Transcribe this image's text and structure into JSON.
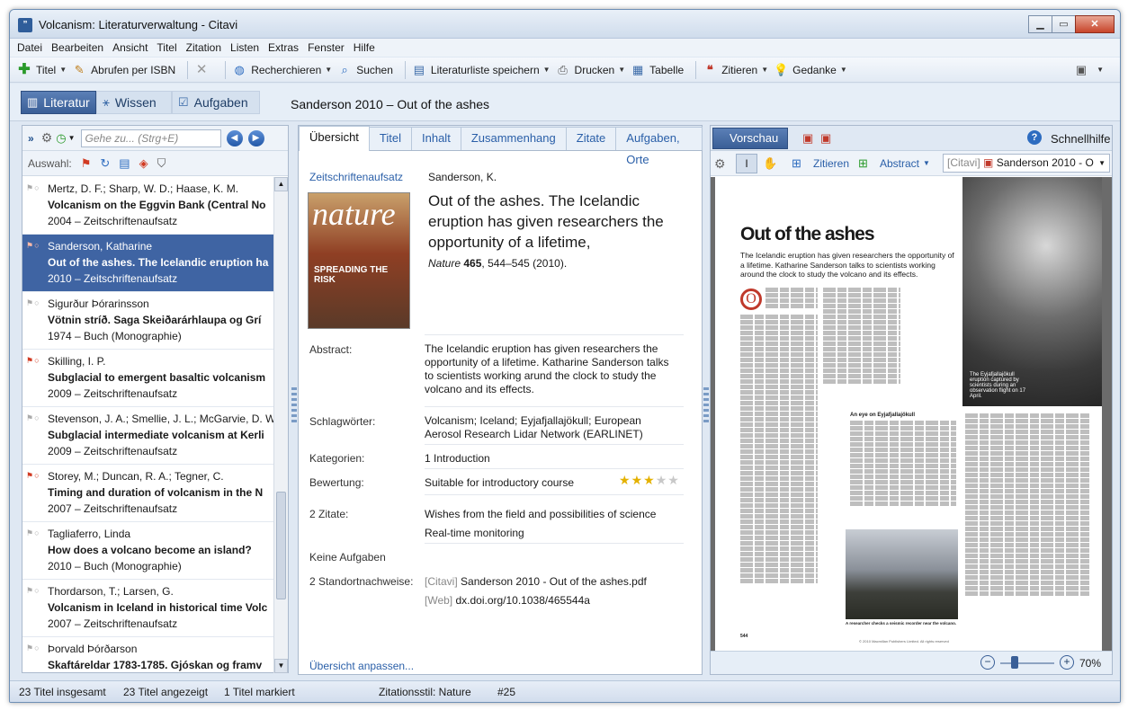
{
  "window": {
    "title": "Volcanism: Literaturverwaltung - Citavi",
    "app_icon": "”"
  },
  "menu": [
    "Datei",
    "Bearbeiten",
    "Ansicht",
    "Titel",
    "Zitation",
    "Listen",
    "Extras",
    "Fenster",
    "Hilfe"
  ],
  "toolbar": {
    "titel": "Titel",
    "abrufen": "Abrufen per ISBN",
    "recherchieren": "Recherchieren",
    "suchen": "Suchen",
    "literaturliste": "Literaturliste speichern",
    "drucken": "Drucken",
    "tabelle": "Tabelle",
    "zitieren": "Zitieren",
    "gedanke": "Gedanke"
  },
  "nav": {
    "literatur": "Literatur",
    "wissen": "Wissen",
    "aufgaben": "Aufgaben"
  },
  "breadcrumb": "Sanderson 2010 – Out of the ashes",
  "left": {
    "search_placeholder": "Gehe zu... (Strg+E)",
    "auswahl": "Auswahl:",
    "items": [
      {
        "authors": "Mertz, D. F.; Sharp, W. D.; Haase, K. M.",
        "title": "Volcanism on the Eggvin Bank (Central No",
        "meta": "2004 – Zeitschriftenaufsatz",
        "flag": false,
        "selected": false
      },
      {
        "authors": "Sanderson, Katharine",
        "title": "Out of the ashes. The Icelandic eruption ha",
        "meta": "2010 – Zeitschriftenaufsatz",
        "flag": true,
        "selected": true
      },
      {
        "authors": "Sigurður Þórarinsson",
        "title": "Vötnin stríð. Saga Skeiðarárhlaupa og Grí",
        "meta": "1974 – Buch (Monographie)",
        "flag": false,
        "selected": false
      },
      {
        "authors": "Skilling, I. P.",
        "title": "Subglacial to emergent basaltic volcanism",
        "meta": "2009 – Zeitschriftenaufsatz",
        "flag": true,
        "selected": false
      },
      {
        "authors": "Stevenson, J. A.; Smellie, J. L.; McGarvie, D. W.;",
        "title": "Subglacial intermediate volcanism at Kerli",
        "meta": "2009 – Zeitschriftenaufsatz",
        "flag": false,
        "selected": false
      },
      {
        "authors": "Storey, M.; Duncan, R. A.; Tegner, C.",
        "title": "Timing and duration of volcanism in the N",
        "meta": "2007 – Zeitschriftenaufsatz",
        "flag": true,
        "selected": false
      },
      {
        "authors": "Tagliaferro, Linda",
        "title": "How does a volcano become an island?",
        "meta": "2010 – Buch (Monographie)",
        "flag": false,
        "selected": false
      },
      {
        "authors": "Thordarson, T.; Larsen, G.",
        "title": "Volcanism in Iceland in historical time Volc",
        "meta": "2007 – Zeitschriftenaufsatz",
        "flag": false,
        "selected": false
      },
      {
        "authors": "Þorvald Þórðarson",
        "title": "Skaftáreldar 1783-1785. Gjóskan og framv",
        "meta": "",
        "flag": false,
        "selected": false
      }
    ]
  },
  "mid": {
    "tabs": [
      "Übersicht",
      "Titel",
      "Inhalt",
      "Zusammenhang",
      "Zitate",
      "Aufgaben, Orte"
    ],
    "type": "Zeitschriftenaufsatz",
    "author": "Sanderson, K.",
    "title": "Out of the ashes. The Icelandic eruption has given researchers the opportunity of a lifetime,",
    "journal": "Nature",
    "volume": "465",
    "pages": ", 544–545 (2010).",
    "cover_logo": "nature",
    "cover_tag": "SPREADING THE RISK",
    "abstract_label": "Abstract:",
    "abstract": "The Icelandic eruption has given researchers the opportunity of a lifetime. Katharine Sanderson talks to scientists working arund the clock to study the volcano and its effects.",
    "keywords_label": "Schlagwörter:",
    "keywords": "Volcanism; Iceland; Eyjafjallajökull; European Aerosol Research Lidar Network (EARLINET)",
    "categories_label": "Kategorien:",
    "categories": "1 Introduction",
    "rating_label": "Bewertung:",
    "rating_text": "Suitable for introductory course",
    "rating_value": 3,
    "rating_max": 5,
    "quotes_label": "2 Zitate:",
    "quote1": "Wishes from the field and possibilities of science",
    "quote2": "Real-time monitoring",
    "tasks_label": "Keine Aufgaben",
    "locations_label": "2 Standortnachweise:",
    "loc1_tag": "[Citavi]",
    "loc1": "Sanderson 2010 - Out of the ashes.pdf",
    "loc2_tag": "[Web]",
    "loc2": "dx.doi.org/10.1038/465544a",
    "customize": "Übersicht anpassen..."
  },
  "right": {
    "vorschau": "Vorschau",
    "schnellhilfe": "Schnellhilfe",
    "zitieren": "Zitieren",
    "abstract": "Abstract",
    "doc_tag": "[Citavi]",
    "doc_name": "Sanderson 2010 - O",
    "pdf_heading": "Out of the ashes",
    "pdf_dek": "The Icelandic eruption has given researchers the opportunity of a lifetime. Katharine Sanderson talks to scientists working around the clock to study the volcano and its effects.",
    "pdf_dropcap": "O",
    "pdf_subhead": "An eye on Eyjafjallajökull",
    "pdf_photo1_cap": "The Eyjafjallajökull eruption captured by scientists during an observation flight on 17 April.",
    "pdf_photo2_cap": "A researcher checks a seismic recorder near the volcano.",
    "pdf_page_no": "544",
    "pdf_copyright": "© 2010 Macmillan Publishers Limited. All rights reserved",
    "zoom": "70%"
  },
  "status": {
    "total": "23 Titel insgesamt",
    "shown": "23 Titel angezeigt",
    "marked": "1 Titel markiert",
    "style": "Zitationsstil: Nature",
    "number": "#25"
  }
}
